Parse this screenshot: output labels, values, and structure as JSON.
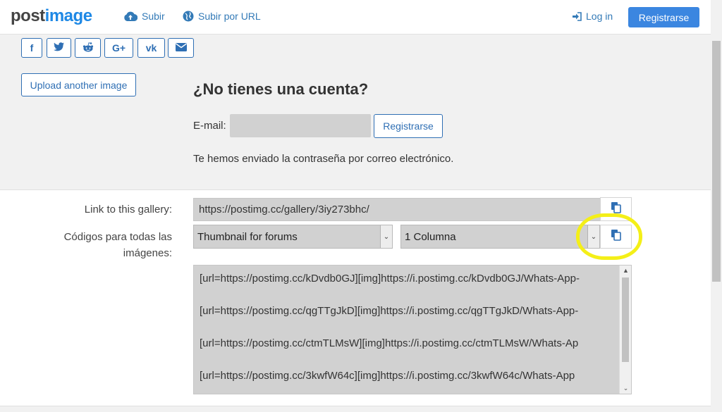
{
  "navbar": {
    "logo_part1": "post",
    "logo_part2": "image",
    "upload_label": "Subir",
    "upload_url_label": "Subir por URL",
    "login_label": "Log in",
    "register_label": "Registrarse"
  },
  "share": {
    "icons": [
      "facebook-icon",
      "twitter-icon",
      "reddit-icon",
      "google-plus-icon",
      "vk-icon",
      "email-icon"
    ],
    "glyphs": [
      "f",
      "t",
      "r",
      "G+",
      "vk",
      "✉"
    ]
  },
  "account": {
    "upload_another_label": "Upload another image",
    "heading": "¿No tienes una cuenta?",
    "email_label": "E-mail:",
    "email_value": "",
    "register_label": "Registrarse",
    "sent_message": "Te hemos enviado la contraseña por correo electrónico."
  },
  "gallery": {
    "link_label": "Link to this gallery:",
    "link_value": "https://postimg.cc/gallery/3iy273bhc/",
    "codes_label_line1": "Códigos para todas las",
    "codes_label_line2": "imágenes:",
    "format_select": "Thumbnail for forums",
    "columns_select": "1 Columna",
    "codes": [
      "[url=https://postimg.cc/kDvdb0GJ][img]https://i.postimg.cc/kDvdb0GJ/Whats-App-",
      "[url=https://postimg.cc/qgTTgJkD][img]https://i.postimg.cc/qgTTgJkD/Whats-App-",
      "[url=https://postimg.cc/ctmTLMsW][img]https://i.postimg.cc/ctmTLMsW/Whats-Ap",
      "[url=https://postimg.cc/3kwfW64c][img]https://i.postimg.cc/3kwfW64c/Whats-App"
    ]
  },
  "colors": {
    "accent": "#3b86e0",
    "link": "#337ab7",
    "highlight": "#f4ef18"
  }
}
